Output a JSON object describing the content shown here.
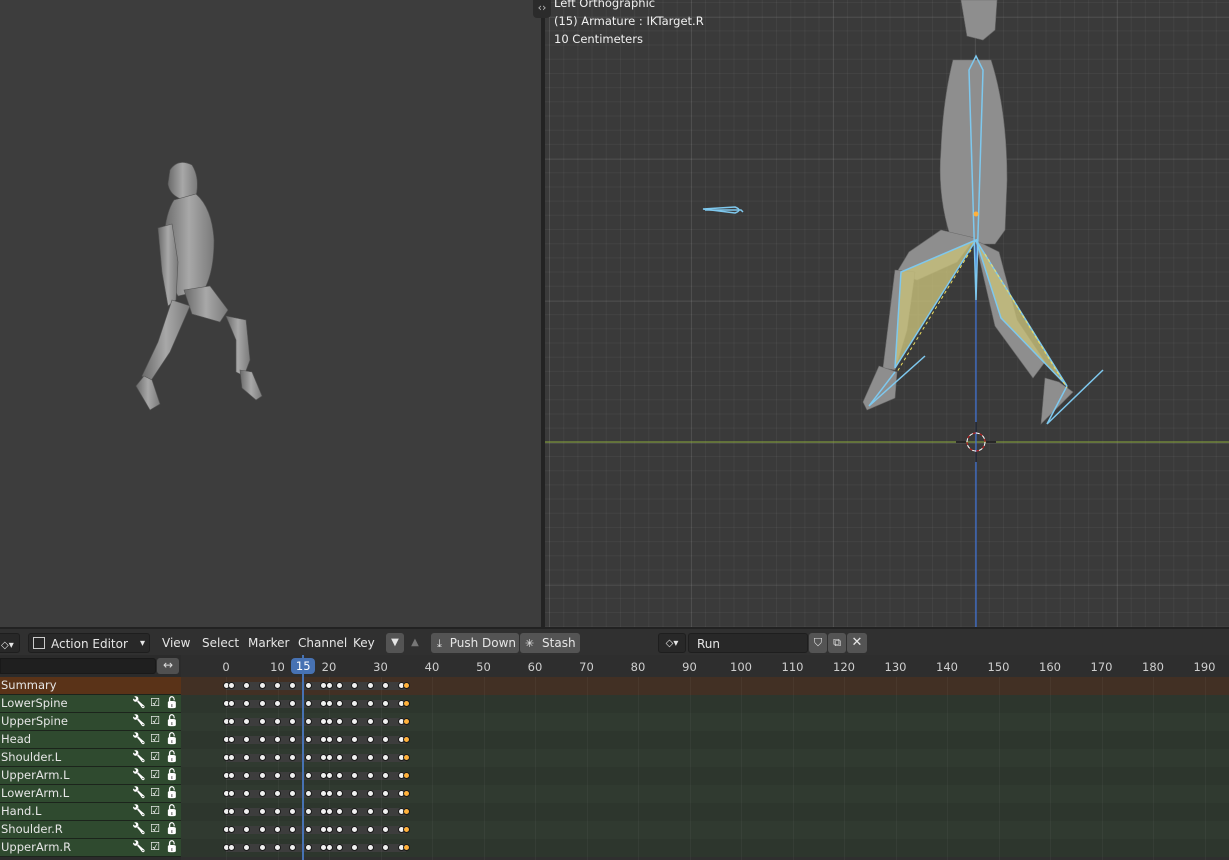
{
  "left_viewport": {},
  "right_viewport": {
    "view_name": "Left Orthographic",
    "object_info": "(15) Armature : IKTarget.R",
    "scale_info": "10 Centimeters"
  },
  "header": {
    "editor_type": "Action Editor",
    "menus": [
      "View",
      "Select",
      "Marker",
      "Channel",
      "Key"
    ],
    "push_down_label": "Push Down",
    "stash_label": "Stash",
    "action_name": "Run"
  },
  "dope_sheet": {
    "search_value": "",
    "current_frame": "15",
    "ruler_labels": [
      "0",
      "10",
      "20",
      "30",
      "40",
      "50",
      "60",
      "70",
      "80",
      "90",
      "100",
      "110",
      "120",
      "130",
      "140",
      "150",
      "160",
      "170",
      "180",
      "190"
    ],
    "channels": [
      {
        "name": "Summary",
        "type": "summary"
      },
      {
        "name": "LowerSpine",
        "type": "group"
      },
      {
        "name": "UpperSpine",
        "type": "group"
      },
      {
        "name": "Head",
        "type": "group"
      },
      {
        "name": "Shoulder.L",
        "type": "group"
      },
      {
        "name": "UpperArm.L",
        "type": "group"
      },
      {
        "name": "LowerArm.L",
        "type": "group"
      },
      {
        "name": "Hand.L",
        "type": "group"
      },
      {
        "name": "Shoulder.R",
        "type": "group"
      },
      {
        "name": "UpperArm.R",
        "type": "group"
      }
    ],
    "keyframe_frames": [
      0,
      1,
      4,
      7,
      10,
      13,
      16,
      19,
      20,
      22,
      25,
      28,
      31,
      34,
      35
    ],
    "selected_frame": 35
  },
  "colors": {
    "playhead": "#4772b3",
    "summary_row": "#5a3318",
    "group_row": "#2f4a2f",
    "selected_key": "#ffb13b",
    "bone": "#7ec8ee",
    "x_axis": "#8aa83a",
    "z_axis": "#3b6fd6"
  },
  "icons": {
    "wrench": "wrench-icon",
    "checkbox": "checkbox-icon",
    "lock": "lock-icon"
  }
}
